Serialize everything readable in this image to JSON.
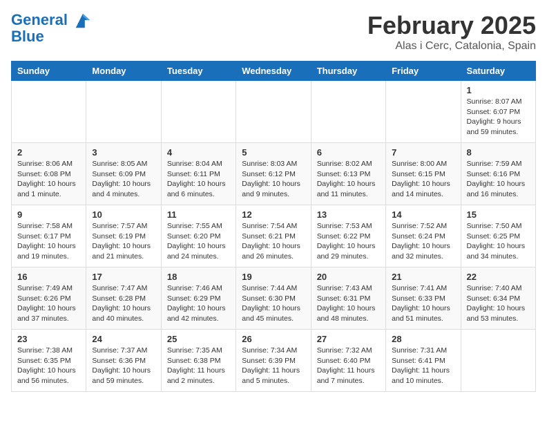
{
  "header": {
    "logo_line1": "General",
    "logo_line2": "Blue",
    "month_year": "February 2025",
    "location": "Alas i Cerc, Catalonia, Spain"
  },
  "days_of_week": [
    "Sunday",
    "Monday",
    "Tuesday",
    "Wednesday",
    "Thursday",
    "Friday",
    "Saturday"
  ],
  "weeks": [
    [
      {
        "day": "",
        "info": ""
      },
      {
        "day": "",
        "info": ""
      },
      {
        "day": "",
        "info": ""
      },
      {
        "day": "",
        "info": ""
      },
      {
        "day": "",
        "info": ""
      },
      {
        "day": "",
        "info": ""
      },
      {
        "day": "1",
        "info": "Sunrise: 8:07 AM\nSunset: 6:07 PM\nDaylight: 9 hours\nand 59 minutes."
      }
    ],
    [
      {
        "day": "2",
        "info": "Sunrise: 8:06 AM\nSunset: 6:08 PM\nDaylight: 10 hours\nand 1 minute."
      },
      {
        "day": "3",
        "info": "Sunrise: 8:05 AM\nSunset: 6:09 PM\nDaylight: 10 hours\nand 4 minutes."
      },
      {
        "day": "4",
        "info": "Sunrise: 8:04 AM\nSunset: 6:11 PM\nDaylight: 10 hours\nand 6 minutes."
      },
      {
        "day": "5",
        "info": "Sunrise: 8:03 AM\nSunset: 6:12 PM\nDaylight: 10 hours\nand 9 minutes."
      },
      {
        "day": "6",
        "info": "Sunrise: 8:02 AM\nSunset: 6:13 PM\nDaylight: 10 hours\nand 11 minutes."
      },
      {
        "day": "7",
        "info": "Sunrise: 8:00 AM\nSunset: 6:15 PM\nDaylight: 10 hours\nand 14 minutes."
      },
      {
        "day": "8",
        "info": "Sunrise: 7:59 AM\nSunset: 6:16 PM\nDaylight: 10 hours\nand 16 minutes."
      }
    ],
    [
      {
        "day": "9",
        "info": "Sunrise: 7:58 AM\nSunset: 6:17 PM\nDaylight: 10 hours\nand 19 minutes."
      },
      {
        "day": "10",
        "info": "Sunrise: 7:57 AM\nSunset: 6:19 PM\nDaylight: 10 hours\nand 21 minutes."
      },
      {
        "day": "11",
        "info": "Sunrise: 7:55 AM\nSunset: 6:20 PM\nDaylight: 10 hours\nand 24 minutes."
      },
      {
        "day": "12",
        "info": "Sunrise: 7:54 AM\nSunset: 6:21 PM\nDaylight: 10 hours\nand 26 minutes."
      },
      {
        "day": "13",
        "info": "Sunrise: 7:53 AM\nSunset: 6:22 PM\nDaylight: 10 hours\nand 29 minutes."
      },
      {
        "day": "14",
        "info": "Sunrise: 7:52 AM\nSunset: 6:24 PM\nDaylight: 10 hours\nand 32 minutes."
      },
      {
        "day": "15",
        "info": "Sunrise: 7:50 AM\nSunset: 6:25 PM\nDaylight: 10 hours\nand 34 minutes."
      }
    ],
    [
      {
        "day": "16",
        "info": "Sunrise: 7:49 AM\nSunset: 6:26 PM\nDaylight: 10 hours\nand 37 minutes."
      },
      {
        "day": "17",
        "info": "Sunrise: 7:47 AM\nSunset: 6:28 PM\nDaylight: 10 hours\nand 40 minutes."
      },
      {
        "day": "18",
        "info": "Sunrise: 7:46 AM\nSunset: 6:29 PM\nDaylight: 10 hours\nand 42 minutes."
      },
      {
        "day": "19",
        "info": "Sunrise: 7:44 AM\nSunset: 6:30 PM\nDaylight: 10 hours\nand 45 minutes."
      },
      {
        "day": "20",
        "info": "Sunrise: 7:43 AM\nSunset: 6:31 PM\nDaylight: 10 hours\nand 48 minutes."
      },
      {
        "day": "21",
        "info": "Sunrise: 7:41 AM\nSunset: 6:33 PM\nDaylight: 10 hours\nand 51 minutes."
      },
      {
        "day": "22",
        "info": "Sunrise: 7:40 AM\nSunset: 6:34 PM\nDaylight: 10 hours\nand 53 minutes."
      }
    ],
    [
      {
        "day": "23",
        "info": "Sunrise: 7:38 AM\nSunset: 6:35 PM\nDaylight: 10 hours\nand 56 minutes."
      },
      {
        "day": "24",
        "info": "Sunrise: 7:37 AM\nSunset: 6:36 PM\nDaylight: 10 hours\nand 59 minutes."
      },
      {
        "day": "25",
        "info": "Sunrise: 7:35 AM\nSunset: 6:38 PM\nDaylight: 11 hours\nand 2 minutes."
      },
      {
        "day": "26",
        "info": "Sunrise: 7:34 AM\nSunset: 6:39 PM\nDaylight: 11 hours\nand 5 minutes."
      },
      {
        "day": "27",
        "info": "Sunrise: 7:32 AM\nSunset: 6:40 PM\nDaylight: 11 hours\nand 7 minutes."
      },
      {
        "day": "28",
        "info": "Sunrise: 7:31 AM\nSunset: 6:41 PM\nDaylight: 11 hours\nand 10 minutes."
      },
      {
        "day": "",
        "info": ""
      }
    ]
  ]
}
